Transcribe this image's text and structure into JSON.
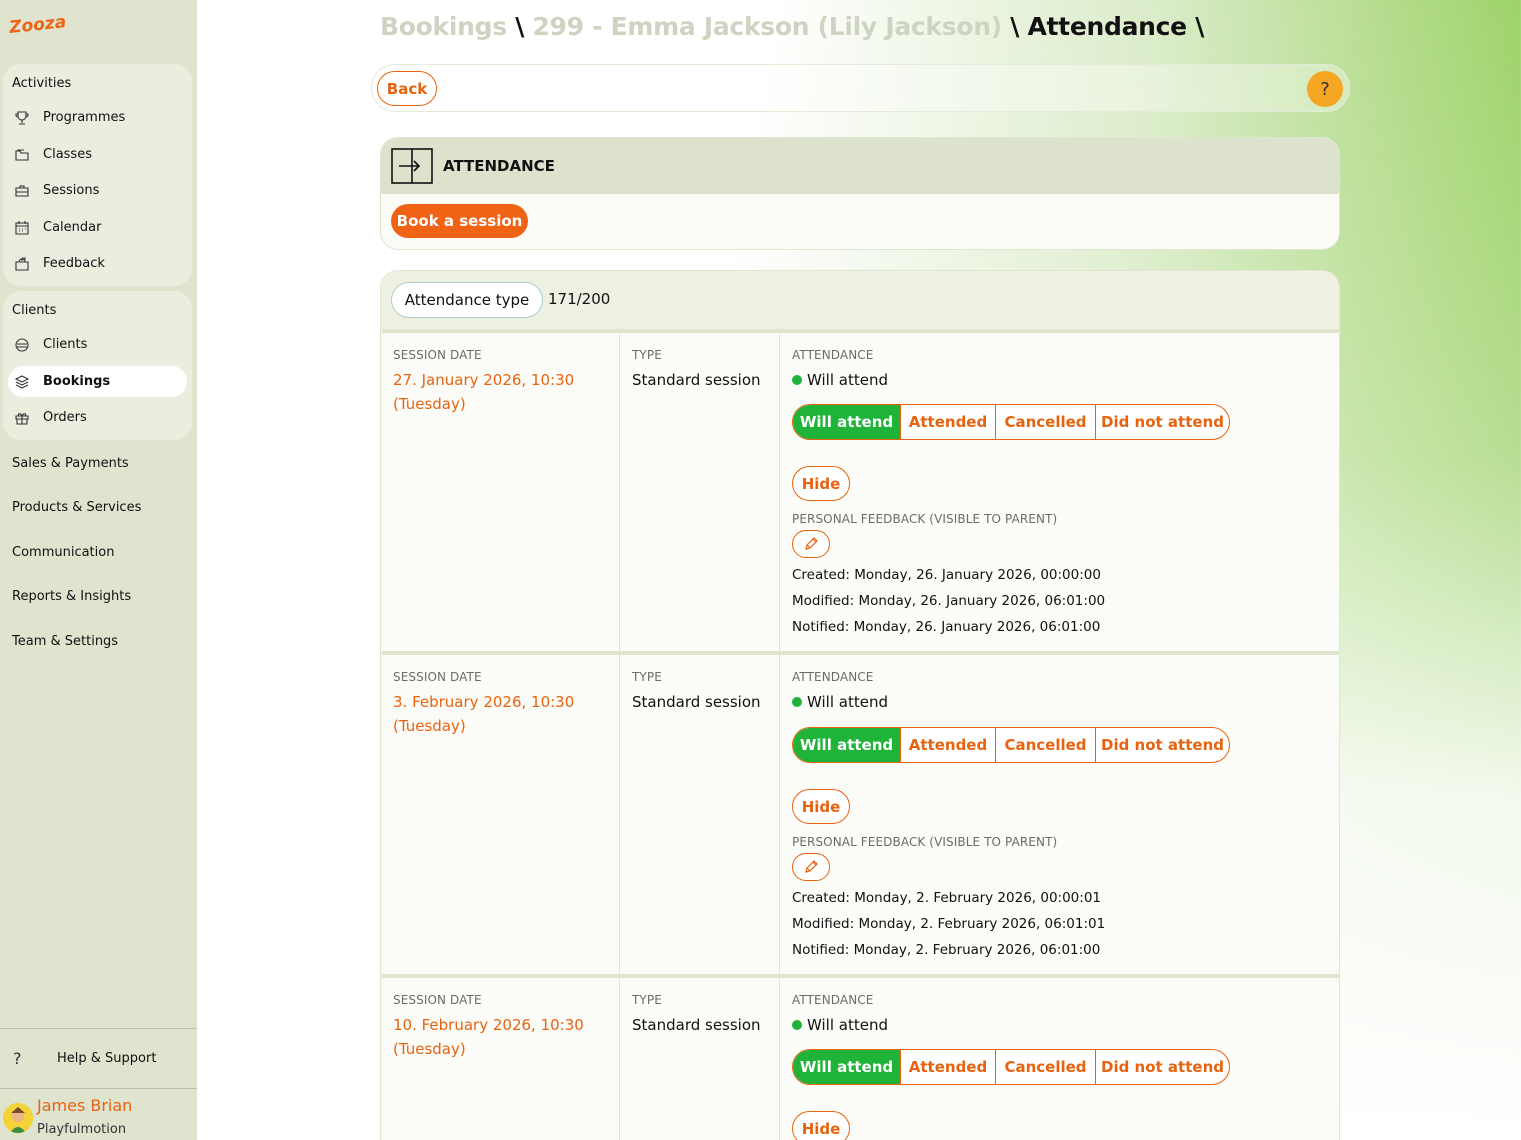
{
  "sidebar": {
    "logo_text": "Zooza",
    "activities": {
      "title": "Activities",
      "items": [
        {
          "label": "Programmes",
          "icon": "trophy-icon"
        },
        {
          "label": "Classes",
          "icon": "folder-icon"
        },
        {
          "label": "Sessions",
          "icon": "briefcase-icon"
        },
        {
          "label": "Calendar",
          "icon": "calendar-icon"
        },
        {
          "label": "Feedback",
          "icon": "mailbox-icon"
        }
      ]
    },
    "clients": {
      "title": "Clients",
      "items": [
        {
          "label": "Clients",
          "icon": "people-icon"
        },
        {
          "label": "Bookings",
          "icon": "layers-icon",
          "active": true
        },
        {
          "label": "Orders",
          "icon": "gift-icon"
        }
      ]
    },
    "top_items": [
      "Sales & Payments",
      "Products & Services",
      "Communication",
      "Reports & Insights",
      "Team & Settings"
    ],
    "help_label": "Help & Support",
    "user": {
      "name": "James Brian",
      "org": "Playfulmotion"
    }
  },
  "breadcrumb": {
    "part1": "Bookings",
    "part2": "299 - Emma Jackson (Lily Jackson)",
    "current": "Attendance",
    "sep": "\\"
  },
  "toolbar": {
    "back_label": "Back",
    "help_label": "?"
  },
  "attendance_card": {
    "title": "ATTENDANCE",
    "book_label": "Book a session"
  },
  "list": {
    "filter_label": "Attendance type",
    "count": "171/200",
    "col_session_date": "SESSION DATE",
    "col_type": "TYPE",
    "col_attendance": "ATTENDANCE",
    "feedback_label": "PERSONAL FEEDBACK (VISIBLE TO PARENT)",
    "options": [
      "Will attend",
      "Attended",
      "Cancelled",
      "Did not attend"
    ],
    "hide_label": "Hide",
    "rows": [
      {
        "date_line1": "27. January 2026, 10:30",
        "date_line2": "(Tuesday)",
        "type": "Standard session",
        "status": "Will attend",
        "created": "Created: Monday, 26. January 2026, 00:00:00",
        "modified": "Modified: Monday, 26. January 2026, 06:01:00",
        "notified": "Notified: Monday, 26. January 2026, 06:01:00"
      },
      {
        "date_line1": "3. February 2026, 10:30",
        "date_line2": "(Tuesday)",
        "type": "Standard session",
        "status": "Will attend",
        "created": "Created: Monday, 2. February 2026, 00:00:01",
        "modified": "Modified: Monday, 2. February 2026, 06:01:01",
        "notified": "Notified: Monday, 2. February 2026, 06:01:00"
      },
      {
        "date_line1": "10. February 2026, 10:30",
        "date_line2": "(Tuesday)",
        "type": "Standard session",
        "status": "Will attend"
      }
    ]
  },
  "colors": {
    "accent": "#e8630f",
    "success": "#1fb33a",
    "help": "#f5a623"
  }
}
